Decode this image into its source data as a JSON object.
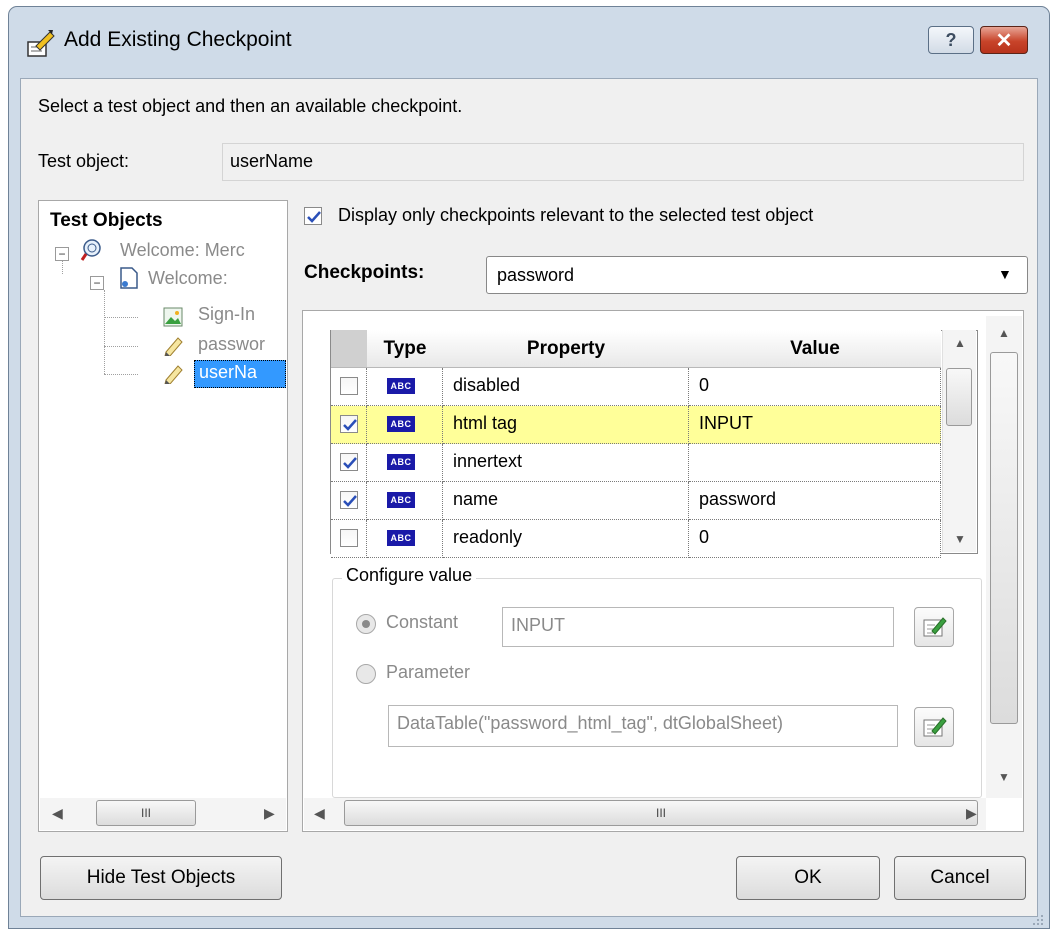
{
  "window": {
    "title": "Add Existing Checkpoint",
    "help_label": "?",
    "close_label": "✕"
  },
  "instructions": "Select a test object and then an available checkpoint.",
  "test_object": {
    "label": "Test object:",
    "value": "userName"
  },
  "tree": {
    "header": "Test Objects",
    "items": [
      {
        "label": "Welcome: Merc",
        "icon": "browser-icon"
      },
      {
        "label": "Welcome:",
        "icon": "page-icon"
      },
      {
        "label": "Sign-In",
        "icon": "image-icon"
      },
      {
        "label": "passwor",
        "icon": "edit-field-icon"
      },
      {
        "label": "userNa",
        "icon": "edit-field-icon",
        "selected": true
      }
    ],
    "scroll_grip": "III"
  },
  "display_relevant": {
    "checked": true,
    "label": "Display only checkpoints relevant to the selected test object"
  },
  "checkpoints": {
    "label": "Checkpoints:",
    "selected": "password"
  },
  "grid": {
    "columns": [
      "Type",
      "Property",
      "Value"
    ],
    "type_badge": "ABC",
    "rows": [
      {
        "checked": false,
        "property": "disabled",
        "value": "0",
        "highlight": false
      },
      {
        "checked": true,
        "property": "html tag",
        "value": "INPUT",
        "highlight": true
      },
      {
        "checked": true,
        "property": "innertext",
        "value": "",
        "highlight": false
      },
      {
        "checked": true,
        "property": "name",
        "value": "password",
        "highlight": false
      },
      {
        "checked": false,
        "property": "readonly",
        "value": "0",
        "highlight": false
      }
    ]
  },
  "configure": {
    "legend": "Configure value",
    "constant_label": "Constant",
    "constant_value": "INPUT",
    "parameter_label": "Parameter",
    "parameter_value": "DataTable(\"password_html_tag\", dtGlobalSheet)",
    "selected_option": "Constant"
  },
  "panel_scroll_grip": "III",
  "buttons": {
    "hide_test_objects": "Hide Test Objects",
    "ok": "OK",
    "cancel": "Cancel"
  },
  "colors": {
    "highlight_row": "#ffff99",
    "title_bar": "#cfdbe8",
    "close_button": "#c8442a",
    "check_mark": "#2a4fb8",
    "selected_tree_item": "#3399ff"
  }
}
